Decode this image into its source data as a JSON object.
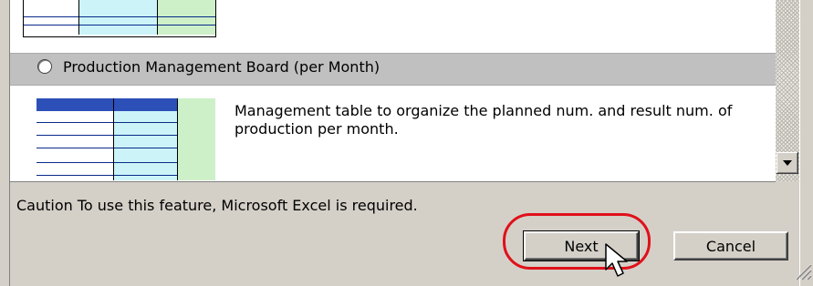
{
  "list": {
    "item_title": "Production Management Board (per Month)",
    "item_description": "Management table to organize the planned num. and result num. of production per month.",
    "item_selected": false
  },
  "caution": "Caution  To use this feature, Microsoft Excel is required.",
  "buttons": {
    "next": "Next",
    "cancel": "Cancel"
  },
  "icons": {
    "scroll_down": "triangle-down-icon",
    "cursor": "arrow-cursor-icon",
    "resize_grip": "resize-grip-icon"
  },
  "colors": {
    "highlight": "#e0101a",
    "selected_bar": "#c0c0c0",
    "dialog_bg": "#d4d0c8"
  }
}
